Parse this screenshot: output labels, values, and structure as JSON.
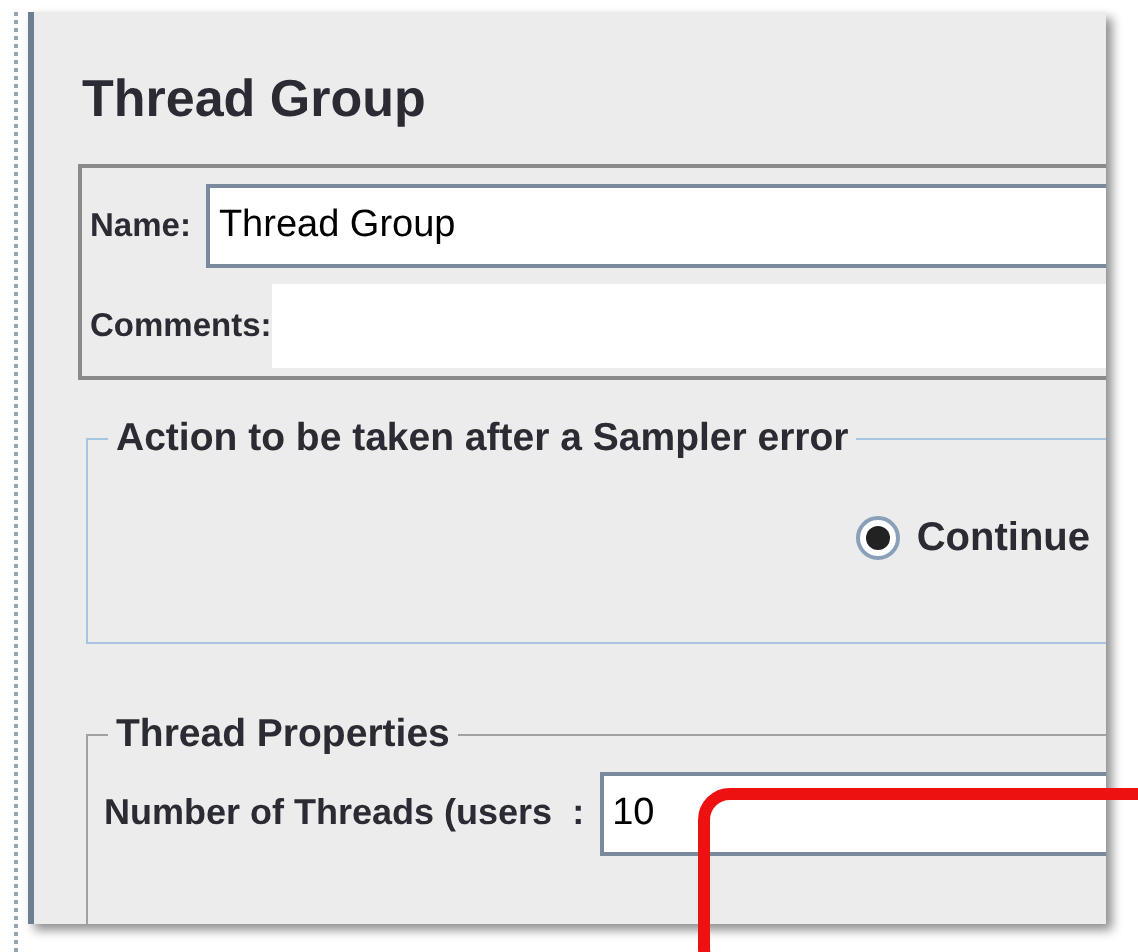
{
  "title": "Thread Group",
  "name": {
    "label": "Name:",
    "value": "Thread Group"
  },
  "comments": {
    "label": "Comments:"
  },
  "sampler_error_action": {
    "legend": "Action to be taken after a Sampler error",
    "options": [
      {
        "label": "Continue",
        "selected": true
      }
    ]
  },
  "thread_properties": {
    "legend": "Thread Properties",
    "fields": [
      {
        "label": "Number of Threads (users",
        "label_tail": ":",
        "value": "10",
        "highlighted": true
      }
    ]
  }
}
